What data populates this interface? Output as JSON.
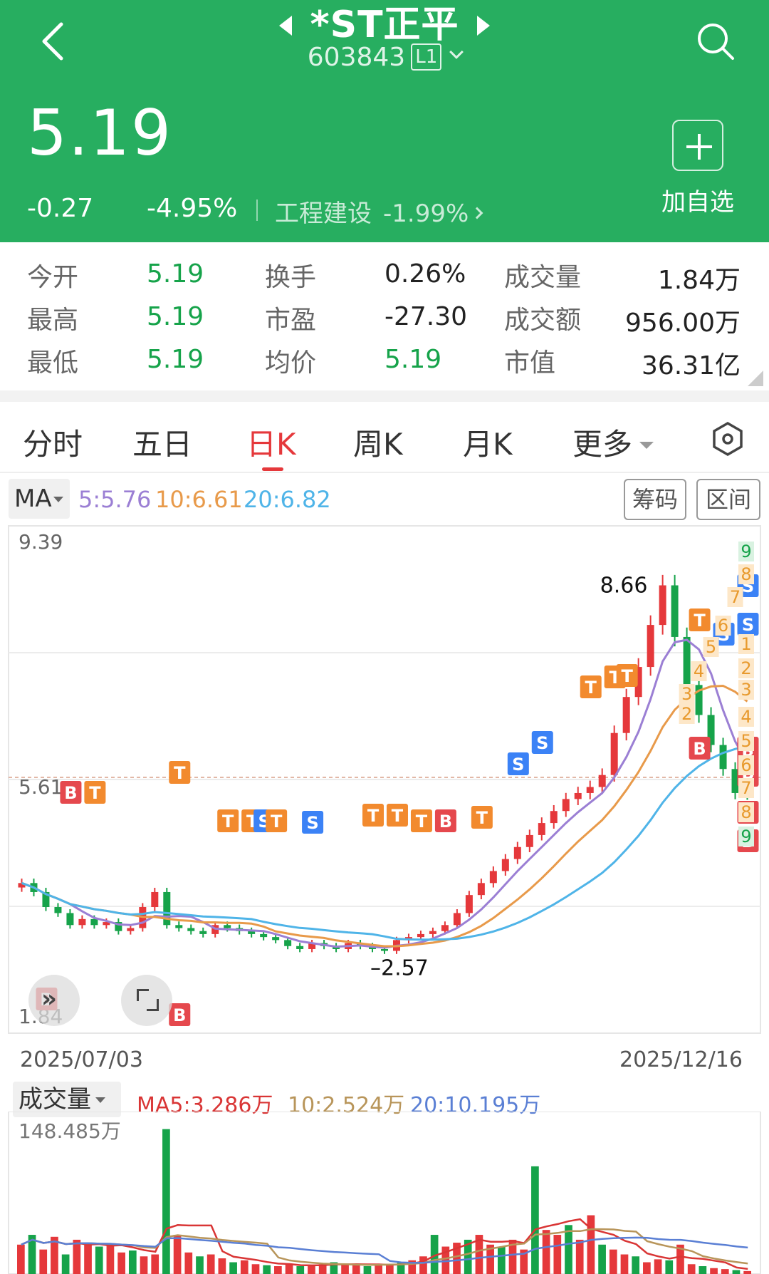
{
  "header": {
    "title": "*ST正平",
    "code": "603843",
    "level_badge": "L1",
    "price": "5.19",
    "change": "-0.27",
    "change_pct": "-4.95%",
    "sector_name": "工程建设",
    "sector_change": "-1.99%",
    "add_watchlist_label": "加自选"
  },
  "stats": [
    {
      "label": "今开",
      "value": "5.19"
    },
    {
      "label": "换手",
      "value": "0.26%"
    },
    {
      "label": "成交量",
      "value": "1.84万"
    },
    {
      "label": "最高",
      "value": "5.19"
    },
    {
      "label": "市盈",
      "value": "-27.30"
    },
    {
      "label": "成交额",
      "value": "956.00万"
    },
    {
      "label": "最低",
      "value": "5.19"
    },
    {
      "label": "均价",
      "value": "5.19"
    },
    {
      "label": "市值",
      "value": "36.31亿"
    }
  ],
  "tabs": [
    "分时",
    "五日",
    "日K",
    "周K",
    "月K",
    "更多"
  ],
  "active_tab": "日K",
  "ma_legend": {
    "selector": "MA",
    "ma5": "5:5.76",
    "ma10": "10:6.61",
    "ma20": "20:6.82"
  },
  "chip_buttons": {
    "chips": "筹码",
    "range": "区间"
  },
  "kline": {
    "y_top_label": "9.39",
    "y_mid_label": "5.61",
    "y_bottom_label": "1.84",
    "high_label": "8.66",
    "low_label": "2.57",
    "date_start": "2025/07/03",
    "date_end": "2025/12/16"
  },
  "volume": {
    "selector": "成交量",
    "ma5": "MA5:3.286万",
    "ma10": "10:2.524万",
    "ma20": "20:10.195万",
    "max_label": "148.485万"
  },
  "colors": {
    "header_green": "#27ae60",
    "up": "#e5383b",
    "down": "#16a34a",
    "ma5": "#9b7fd4",
    "ma10": "#e89a4a",
    "ma20": "#4fb4e8",
    "vol_ma5": "#d93535",
    "vol_ma10": "#b8955a",
    "vol_ma20": "#5a7fd4"
  },
  "icons": {
    "back": "back-arrow-icon",
    "search": "search-icon",
    "add": "plus-icon",
    "settings": "hexagon-settings-icon",
    "forward": "fast-forward-icon",
    "fullscreen": "fullscreen-icon"
  },
  "chart_data": [
    {
      "type": "candlestick",
      "title": "",
      "x_range": [
        "2025/07/03",
        "2025/12/16"
      ],
      "ylim": [
        1.84,
        9.39
      ],
      "marked_high": 8.66,
      "marked_low": 2.57,
      "reference_price": 5.46,
      "series": [
        {
          "name": "5",
          "last": 5.76
        },
        {
          "name": "10",
          "last": 6.61
        },
        {
          "name": "20",
          "last": 6.82
        }
      ],
      "close_path": [
        3.7,
        3.55,
        3.3,
        3.2,
        3.0,
        3.1,
        3.0,
        3.05,
        2.9,
        2.95,
        3.3,
        3.55,
        3.0,
        2.95,
        2.9,
        2.85,
        3.0,
        2.95,
        2.9,
        2.85,
        2.8,
        2.75,
        2.65,
        2.6,
        2.7,
        2.65,
        2.6,
        2.7,
        2.65,
        2.6,
        2.57,
        2.75,
        2.8,
        2.85,
        2.9,
        3.0,
        3.2,
        3.5,
        3.7,
        3.9,
        4.1,
        4.3,
        4.5,
        4.7,
        4.9,
        5.1,
        5.2,
        5.3,
        5.5,
        6.2,
        6.8,
        7.3,
        8.0,
        8.66,
        7.8,
        7.0,
        6.5,
        6.0,
        5.6,
        5.2,
        5.19
      ],
      "signals_visible": [
        "B",
        "S",
        "T",
        "1",
        "2",
        "3",
        "4",
        "5",
        "6",
        "7",
        "8",
        "9"
      ]
    },
    {
      "type": "bar",
      "title": "成交量",
      "unit": "万",
      "ylim": [
        0,
        148.485
      ],
      "series": [
        {
          "name": "MA5",
          "last": 3.286
        },
        {
          "name": "10",
          "last": 2.524
        },
        {
          "name": "20",
          "last": 10.195
        }
      ],
      "values": [
        30,
        40,
        25,
        38,
        20,
        35,
        32,
        28,
        30,
        22,
        24,
        18,
        20,
        148,
        40,
        22,
        18,
        20,
        16,
        12,
        14,
        10,
        9,
        8,
        10,
        8,
        9,
        10,
        12,
        10,
        9,
        8,
        10,
        10,
        12,
        14,
        18,
        40,
        28,
        32,
        35,
        40,
        30,
        28,
        35,
        25,
        110,
        45,
        40,
        50,
        35,
        60,
        30,
        25,
        20,
        18,
        12,
        15,
        14,
        30,
        10,
        8,
        6,
        5,
        4,
        3
      ]
    }
  ]
}
